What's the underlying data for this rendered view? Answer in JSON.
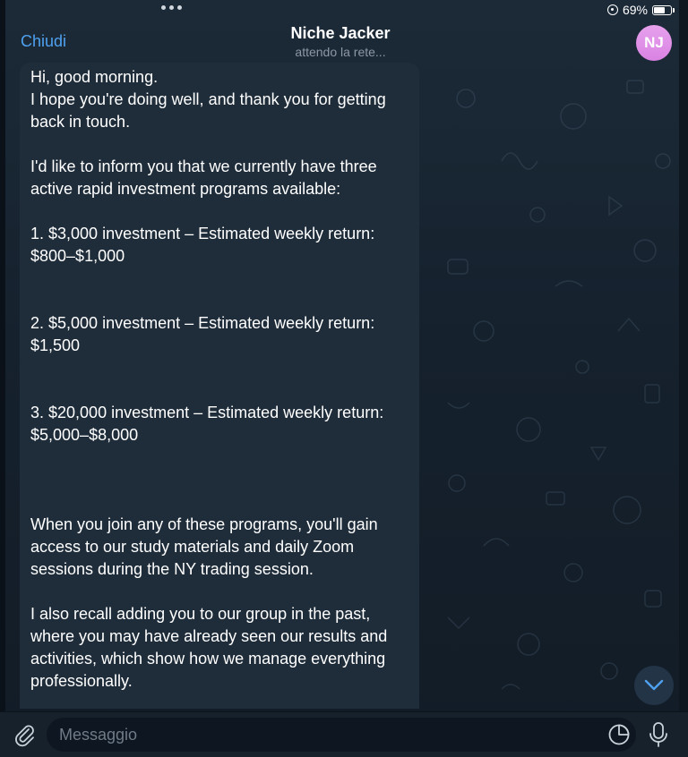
{
  "status_bar": {
    "battery_text": "69%",
    "battery_level": 0.69
  },
  "header": {
    "close_label": "Chiudi",
    "title": "Niche Jacker",
    "subtitle": "attendo la rete...",
    "avatar_initials": "NJ"
  },
  "message": {
    "greeting": "Hi, good morning.",
    "line1": "I hope you're doing well, and thank you for getting back in touch.",
    "intro": "I'd like to inform you that we currently have three active rapid investment programs available:",
    "program1": "1. $3,000 investment – Estimated weekly return: $800–$1,000",
    "program2": "2. $5,000 investment – Estimated weekly return: $1,500",
    "program3": "3. $20,000 investment – Estimated weekly return: $5,000–$8,000",
    "join_text": "When you join any of these programs, you'll gain access to our study materials and daily Zoom sessions during the NY trading session.",
    "recall_text": "I also recall adding you to our group in the past, where you may have already seen our results and activities, which show how we manage everything professionally."
  },
  "composer": {
    "placeholder": "Messaggio"
  },
  "icons": {
    "more": "more-dots-icon",
    "orientation": "orientation-lock-icon",
    "battery": "battery-icon",
    "attach": "paperclip-icon",
    "sticker": "sticker-icon",
    "mic": "microphone-icon",
    "scroll": "chevron-down-icon"
  },
  "colors": {
    "accent": "#4ea1f0",
    "bubble": "#1f2d3b",
    "avatar": "#dd8ae6",
    "background": "#17212b"
  }
}
